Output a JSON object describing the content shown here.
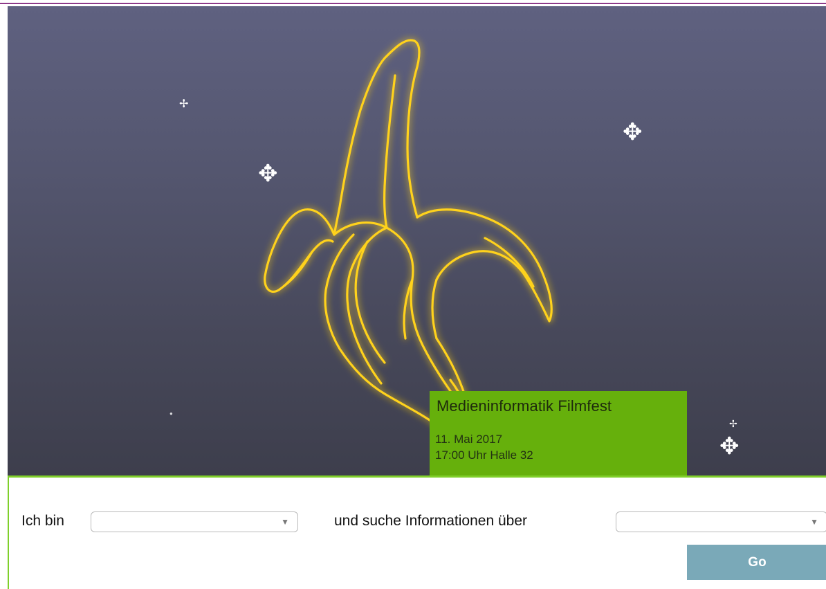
{
  "event": {
    "title": "Medieninformatik Filmfest",
    "date": "11. Mai 2017",
    "time_place": "17:00 Uhr Halle 32"
  },
  "search": {
    "label_role": "Ich bin",
    "role_value": "",
    "label_topic": "und suche Informationen über",
    "topic_value": "",
    "dropdown_arrow": "▼",
    "go_label": "Go"
  },
  "icons": {
    "sparkle": "four-point-sparkle-icon",
    "banana": "neon-banana-icon"
  },
  "colors": {
    "accent_green": "#66b00c",
    "border_green": "#7fcf2a",
    "top_rule": "#8e3a8a",
    "go_button": "#7aa9b8",
    "neon_yellow": "#ffd21a"
  }
}
